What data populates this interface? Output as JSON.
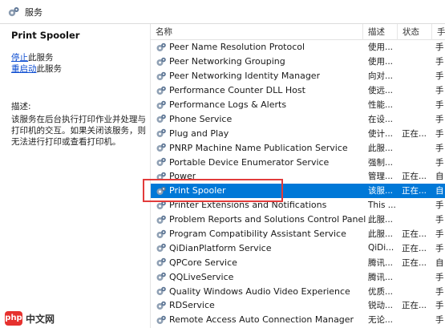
{
  "window": {
    "title": "服务"
  },
  "left_panel": {
    "service_name": "Print Spooler",
    "stop_link": "停止",
    "stop_suffix": "此服务",
    "restart_link": "重启动",
    "restart_suffix": "此服务",
    "description_label": "描述:",
    "description": "该服务在后台执行打印作业并处理与打印机的交互。如果关闭该服务，则无法进行打印或查看打印机。"
  },
  "table": {
    "columns": {
      "name": "名称",
      "description": "描述",
      "status": "状态",
      "startup": "手"
    },
    "rows": [
      {
        "name": "Peer Name Resolution Protocol",
        "description": "使用...",
        "status": "",
        "startup": "手"
      },
      {
        "name": "Peer Networking Grouping",
        "description": "使用...",
        "status": "",
        "startup": "手"
      },
      {
        "name": "Peer Networking Identity Manager",
        "description": "向对...",
        "status": "",
        "startup": "手"
      },
      {
        "name": "Performance Counter DLL Host",
        "description": "使远...",
        "status": "",
        "startup": "手"
      },
      {
        "name": "Performance Logs & Alerts",
        "description": "性能...",
        "status": "",
        "startup": "手"
      },
      {
        "name": "Phone Service",
        "description": "在设...",
        "status": "",
        "startup": "手"
      },
      {
        "name": "Plug and Play",
        "description": "使计...",
        "status": "正在...",
        "startup": "手"
      },
      {
        "name": "PNRP Machine Name Publication Service",
        "description": "此服...",
        "status": "",
        "startup": "手"
      },
      {
        "name": "Portable Device Enumerator Service",
        "description": "强制...",
        "status": "",
        "startup": "手"
      },
      {
        "name": "Power",
        "description": "管理...",
        "status": "正在...",
        "startup": "自"
      },
      {
        "name": "Print Spooler",
        "description": "该服...",
        "status": "正在...",
        "startup": "自",
        "selected": true
      },
      {
        "name": "Printer Extensions and Notifications",
        "description": "This ...",
        "status": "",
        "startup": "手"
      },
      {
        "name": "Problem Reports and Solutions Control Panel Support",
        "description": "此服...",
        "status": "",
        "startup": "手"
      },
      {
        "name": "Program Compatibility Assistant Service",
        "description": "此服...",
        "status": "正在...",
        "startup": "手"
      },
      {
        "name": "QiDianPlatform Service",
        "description": "QiDi...",
        "status": "正在...",
        "startup": "手"
      },
      {
        "name": "QPCore Service",
        "description": "腾讯...",
        "status": "正在...",
        "startup": "自"
      },
      {
        "name": "QQLiveService",
        "description": "腾讯...",
        "status": "",
        "startup": "手"
      },
      {
        "name": "Quality Windows Audio Video Experience",
        "description": "优质...",
        "status": "",
        "startup": "手"
      },
      {
        "name": "RDService",
        "description": "锐动...",
        "status": "正在...",
        "startup": "手"
      },
      {
        "name": "Remote Access Auto Connection Manager",
        "description": "无论...",
        "status": "",
        "startup": "手"
      }
    ]
  },
  "watermark": {
    "logo": "php",
    "text": "中文网"
  },
  "colors": {
    "selection": "#0078d7",
    "link": "#0a4bd0",
    "highlight": "#e23b3b"
  },
  "icons": {
    "title": "services-gear-icon",
    "row": "service-gear-icon"
  }
}
